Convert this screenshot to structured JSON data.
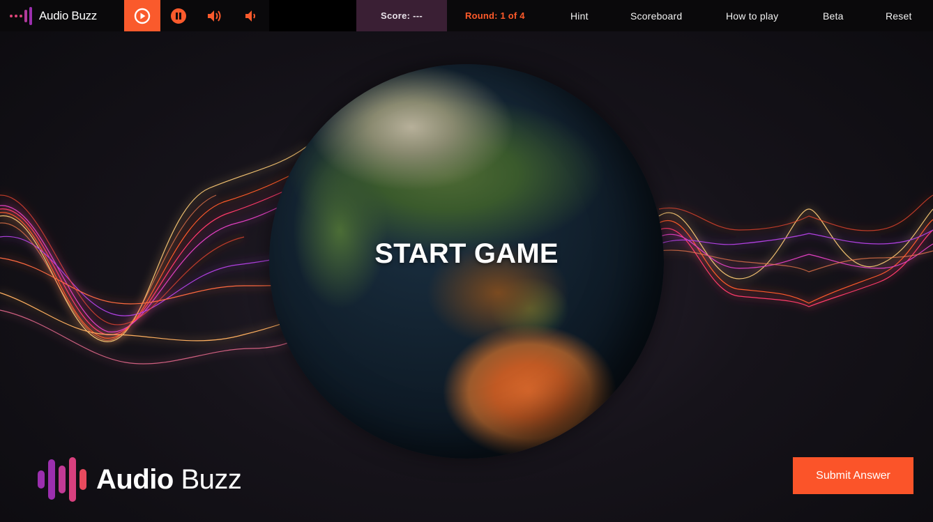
{
  "brand": {
    "name": "Audio Buzz",
    "colors": {
      "pink": "#e0457b",
      "purple": "#9b2fae",
      "orange": "#fa5a2c"
    }
  },
  "controls": [
    {
      "icon": "play-circle-icon",
      "active": true
    },
    {
      "icon": "pause-icon",
      "active": false
    },
    {
      "icon": "volume-up-icon",
      "active": false
    },
    {
      "icon": "volume-down-icon",
      "active": false
    }
  ],
  "header": {
    "score": "Score: ---",
    "round": "Round: 1 of 4",
    "nav": {
      "hint": "Hint",
      "scoreboard": "Scoreboard",
      "how_to_play": "How to play",
      "beta": "Beta",
      "reset": "Reset"
    }
  },
  "main": {
    "start_label": "START GAME"
  },
  "footer": {
    "logo_bold": "Audio",
    "logo_light": "Buzz",
    "submit_label": "Submit Answer"
  }
}
